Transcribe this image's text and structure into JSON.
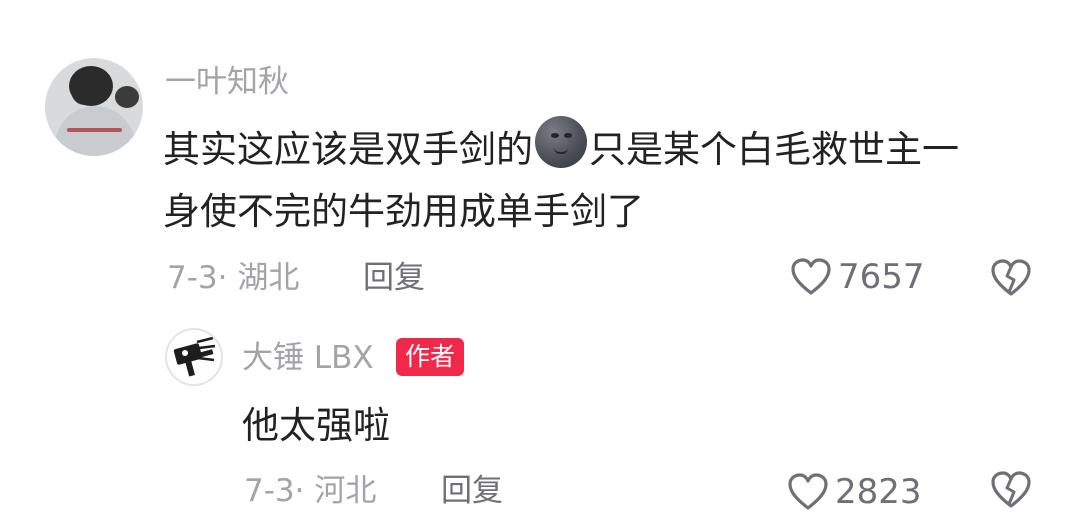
{
  "comment": {
    "username": "一叶知秋",
    "text_line1_before_emoji": "其实这应该是双手剑的",
    "emoji": "moon-face-emoji",
    "text_line1_after_emoji": "只是某个白毛救世主一",
    "text_line2": "身使不完的牛劲用成单手剑了",
    "meta": "7-3· 湖北",
    "reply_label": "回复",
    "like_count": "7657"
  },
  "reply": {
    "username": "大锤 LBX",
    "badge": "作者",
    "text": "他太强啦",
    "meta": "7-3· 河北",
    "reply_label": "回复",
    "like_count": "2823"
  },
  "colors": {
    "text_primary": "#222224",
    "text_secondary": "#a3a3a8",
    "badge_bg": "#f0284a"
  }
}
